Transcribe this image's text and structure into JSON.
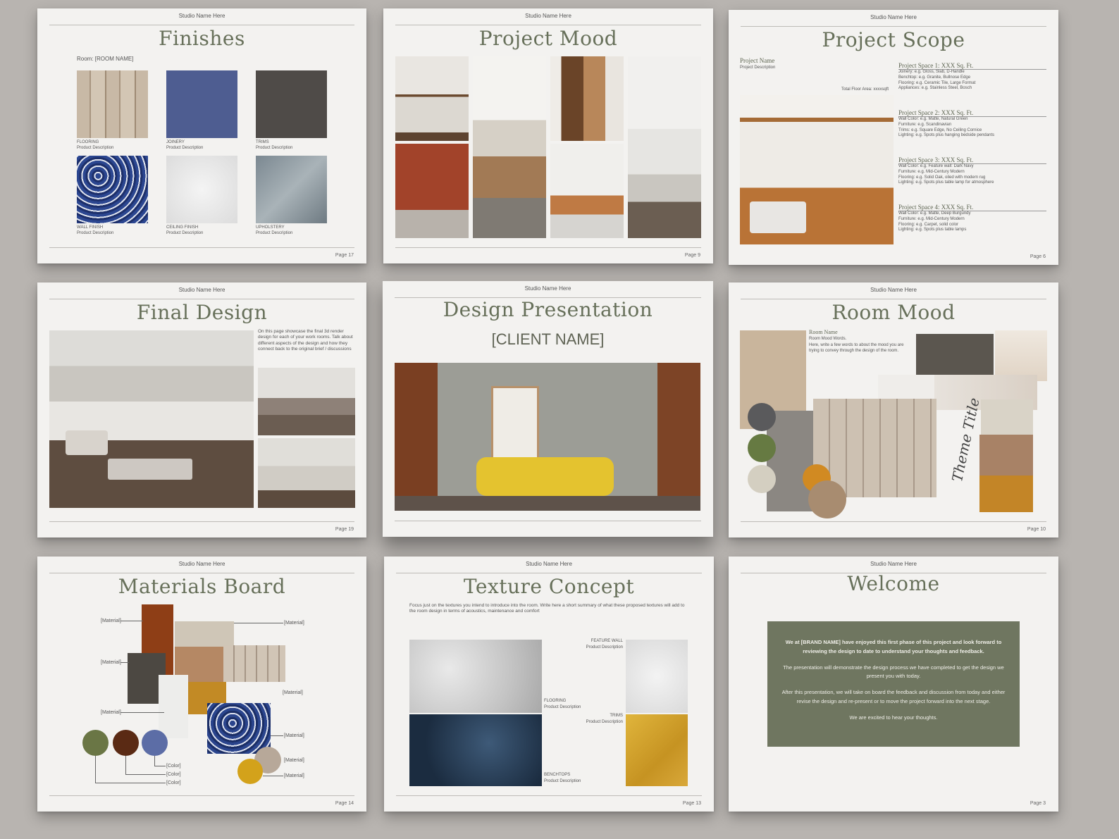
{
  "studio": "Studio Name Here",
  "pages": {
    "finishes": {
      "title": "Finishes",
      "room": "Room: [ROOM NAME]",
      "items": [
        {
          "label": "FLOORING",
          "desc": "Product Description"
        },
        {
          "label": "JOINERY",
          "desc": "Product Description"
        },
        {
          "label": "TRIMS",
          "desc": "Product Description"
        },
        {
          "label": "WALL FINISH",
          "desc": "Product Description"
        },
        {
          "label": "CEILING FINISH",
          "desc": "Product Description"
        },
        {
          "label": "UPHOLSTERY",
          "desc": "Product Description"
        }
      ],
      "page": "Page 17"
    },
    "mood": {
      "title": "Project Mood",
      "page": "Page 9"
    },
    "scope": {
      "title": "Project Scope",
      "project_name": "Project Name",
      "project_desc": "Project Description",
      "total_area": "Total Floor Area: xxxxsqft",
      "spaces": [
        {
          "heading": "Project Space 1: XXX Sq. Ft.",
          "lines": [
            "Joinery: e.g. Gloss, Slab, D-Handle",
            "Benchtop: e.g. Granite, Bullnose Edge",
            "Flooring: e.g. Ceramic Tile, Large Format",
            "Appliances: e.g. Stainless Steel, Bosch"
          ]
        },
        {
          "heading": "Project Space 2: XXX Sq. Ft.",
          "lines": [
            "Wall Color: e.g. Matte, Natural Green",
            "Furniture: e.g. Scandinavian",
            "Trims: e.g. Square Edge, No Ceiling Cornice",
            "Lighting: e.g. Spots plus hanging bedside pendants"
          ]
        },
        {
          "heading": "Project Space 3: XXX Sq. Ft.",
          "lines": [
            "Wall Color: e.g. Feature wall: Dark Navy",
            "Furniture: e.g. Mid-Century Modern",
            "Flooring: e.g. Solid Oak, oiled with modern rug",
            "Lighting: e.g. Spots plus table lamp for atmosphere"
          ]
        },
        {
          "heading": "Project Space 4: XXX Sq. Ft.",
          "lines": [
            "Wall Color: e.g. Matte, Deep Burgundy",
            "Furniture: e.g. Mid-Century Modern",
            "Flooring: e.g. Carpet, solid color",
            "Lighting: e.g. Spots plus table lamps"
          ]
        }
      ],
      "page": "Page 6"
    },
    "final": {
      "title": "Final Design",
      "text": "On this page showcase the final 3d render design for each of your work rooms. Talk about different aspects of the design and how they connect back to the original brief / discussions",
      "page": "Page 19"
    },
    "presentation": {
      "title": "Design Presentation",
      "client": "[CLIENT NAME]"
    },
    "roommood": {
      "title": "Room Mood",
      "room_name": "Room Name",
      "words": "Room Mood Words.",
      "text": "Here, write a few words to about the mood you are trying to convey through the design of the room.",
      "theme": "Theme Title",
      "page": "Page 10"
    },
    "materials": {
      "title": "Materials Board",
      "material": "[Material]",
      "color": "[Color]",
      "page": "Page 14"
    },
    "texture": {
      "title": "Texture Concept",
      "intro": "Focus just on the textures you intend to introduce into the room. Write here a short summary of what these proposed textures will add to the room design in terms of acoustics, maintenance and comfort",
      "items": [
        {
          "label": "FEATURE WALL",
          "desc": "Product Description"
        },
        {
          "label": "FLOORING",
          "desc": "Product Description"
        },
        {
          "label": "TRIMS",
          "desc": "Product Description"
        },
        {
          "label": "BENCHTOPS",
          "desc": "Product Description"
        }
      ],
      "page": "Page 13"
    },
    "welcome": {
      "title": "Welcome",
      "p1": "We at [BRAND NAME] have enjoyed this first phase of this project and look forward to reviewing the design to date to understand your thoughts and feedback.",
      "p2": "The presentation will demonstrate the design process we have completed to get the design we present you with today.",
      "p3": "After this presentation, we will take on board the feedback and discussion from today and either revise the design and re-present or to move the project forward into the next stage.",
      "p4": "We are excited to hear your thoughts.",
      "page": "Page 3"
    }
  },
  "colors": {
    "accent": "#67705a",
    "welcome_box": "#6f7660",
    "olive": "#6a7645",
    "rust": "#5a2a14",
    "blue": "#5c6da6"
  }
}
